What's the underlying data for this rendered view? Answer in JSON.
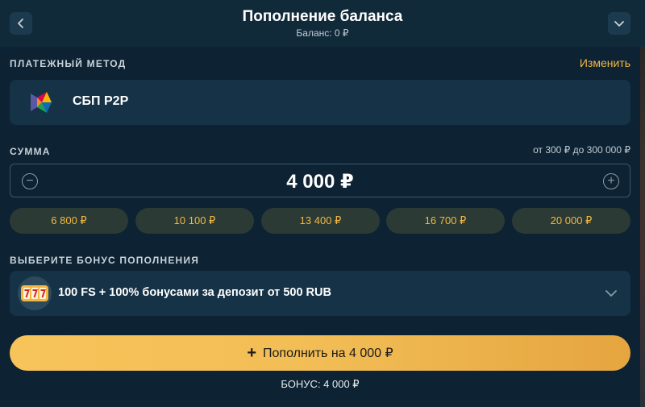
{
  "header": {
    "title": "Пополнение баланса",
    "balance": "Баланс: 0 ₽",
    "back_icon": "chevron-left-icon",
    "collapse_icon": "chevron-down-icon"
  },
  "payment_method": {
    "label": "ПЛАТЕЖНЫЙ МЕТОД",
    "change_label": "Изменить",
    "name": "СБП P2P",
    "logo_icon": "sbp-logo-icon"
  },
  "amount": {
    "label": "СУММА",
    "range": "от 300 ₽ до 300 000 ₽",
    "value": "4 000 ₽",
    "minus": "−",
    "plus": "+",
    "quick_amounts": [
      "6 800 ₽",
      "10 100 ₽",
      "13 400 ₽",
      "16 700 ₽",
      "20 000 ₽"
    ]
  },
  "bonus": {
    "label": "ВЫБЕРИТЕ БОНУС ПОПОЛНЕНИЯ",
    "selected": "100 FS + 100% бонусами за депозит от 500 RUB",
    "icon": "slot-machine-777-icon"
  },
  "submit": {
    "plus": "+",
    "label": "Пополнить на 4 000 ₽"
  },
  "bonus_total": "БОНУС: 4 000 ₽",
  "colors": {
    "background": "#0d2232",
    "card": "#153246",
    "accent": "#f3b842",
    "chip": "#2b3a34"
  }
}
